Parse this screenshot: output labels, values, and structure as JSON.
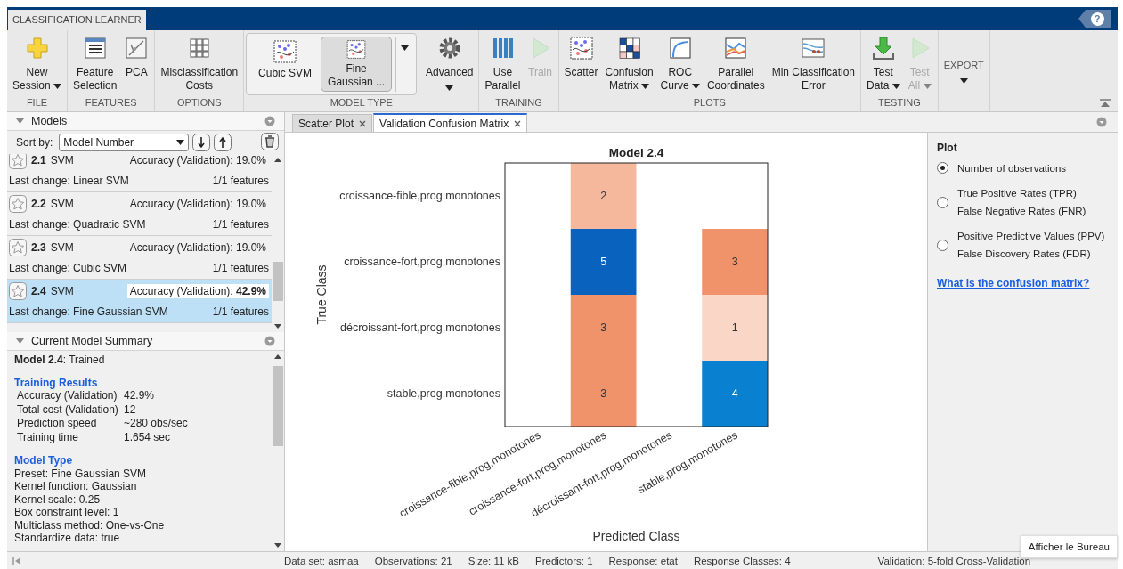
{
  "app": {
    "tab": "CLASSIFICATION LEARNER",
    "help": "?"
  },
  "toolstrip": {
    "sections": [
      {
        "label": "FILE",
        "buttons": [
          {
            "lines": [
              "New",
              "Session"
            ],
            "dropdown": true,
            "disabled": false
          }
        ]
      },
      {
        "label": "FEATURES",
        "buttons": [
          {
            "lines": [
              "Feature",
              "Selection"
            ],
            "disabled": false
          },
          {
            "lines": [
              "PCA"
            ],
            "disabled": false
          }
        ]
      },
      {
        "label": "OPTIONS",
        "buttons": [
          {
            "lines": [
              "Misclassification",
              "Costs"
            ],
            "disabled": false
          }
        ]
      },
      {
        "label": "MODEL TYPE",
        "gallery": [
          {
            "lines": [
              "Cubic SVM"
            ],
            "selected": false
          },
          {
            "lines": [
              "Fine",
              "Gaussian ..."
            ],
            "selected": true
          }
        ],
        "buttons": [
          {
            "lines": [
              "Advanced"
            ],
            "dropdown": true,
            "caret_below": true,
            "disabled": false
          }
        ]
      },
      {
        "label": "TRAINING",
        "buttons": [
          {
            "lines": [
              "Use",
              "Parallel"
            ],
            "disabled": false
          },
          {
            "lines": [
              "Train"
            ],
            "disabled": true
          }
        ]
      },
      {
        "label": "PLOTS",
        "buttons": [
          {
            "lines": [
              "Scatter"
            ],
            "disabled": false
          },
          {
            "lines": [
              "Confusion",
              "Matrix"
            ],
            "dropdown": true,
            "disabled": false
          },
          {
            "lines": [
              "ROC",
              "Curve"
            ],
            "dropdown": true,
            "disabled": false
          },
          {
            "lines": [
              "Parallel",
              "Coordinates"
            ],
            "disabled": false
          },
          {
            "lines": [
              "Min Classification",
              "Error"
            ],
            "disabled": false
          }
        ]
      },
      {
        "label": "TESTING",
        "buttons": [
          {
            "lines": [
              "Test",
              "Data"
            ],
            "dropdown": true,
            "disabled": false
          },
          {
            "lines": [
              "Test",
              "All"
            ],
            "dropdown": true,
            "disabled": true
          }
        ]
      },
      {
        "buttons": [
          {
            "lines": [
              "EXPORT"
            ],
            "dropdown": true,
            "caret_below": true,
            "disabled": false
          }
        ]
      }
    ]
  },
  "models": {
    "title": "Models",
    "sort_label": "Sort by:",
    "sort_value": "Model Number",
    "items": [
      {
        "number": "2.1",
        "type": "SVM",
        "accuracy": "Accuracy (Validation): 19.0%",
        "last_change": "Last change: Linear SVM",
        "features": "1/1 features",
        "starred": false,
        "selected": false
      },
      {
        "number": "2.2",
        "type": "SVM",
        "accuracy": "Accuracy (Validation): 19.0%",
        "last_change": "Last change: Quadratic SVM",
        "features": "1/1 features",
        "starred": false,
        "selected": false
      },
      {
        "number": "2.3",
        "type": "SVM",
        "accuracy": "Accuracy (Validation): 19.0%",
        "last_change": "Last change: Cubic SVM",
        "features": "1/1 features",
        "starred": false,
        "selected": false
      },
      {
        "number": "2.4",
        "type": "SVM",
        "accuracy": "Accuracy (Validation): **42.9%**",
        "last_change": "Last change: Fine Gaussian SVM",
        "features": "1/1 features",
        "starred": false,
        "selected": true
      }
    ]
  },
  "summary": {
    "title": "Current Model Summary",
    "heading": "**Model 2.4**: Trained",
    "sections": [
      {
        "title": "Training Results",
        "rows": [
          {
            "label": "Accuracy (Validation)",
            "value": "42.9%"
          },
          {
            "label": "Total cost (Validation)",
            "value": "12"
          },
          {
            "label": "Prediction speed",
            "value": "~280 obs/sec"
          },
          {
            "label": "Training time",
            "value": "1.654 sec"
          }
        ]
      },
      {
        "title": "Model Type",
        "lines": [
          "Preset: Fine Gaussian SVM",
          "Kernel function: Gaussian",
          "Kernel scale: 0.25",
          "Box constraint level: 1",
          "Multiclass method: One-vs-One",
          "Standardize data: true"
        ]
      }
    ]
  },
  "doc_tabs": [
    {
      "label": "Scatter Plot",
      "selected": false
    },
    {
      "label": "Validation Confusion Matrix",
      "selected": true
    }
  ],
  "matrix": {
    "title": "Model 2.4",
    "ylabel": "True Class",
    "xlabel": "Predicted Class",
    "column_labels": [
      "croissance-fible,prog,monotones",
      "croissance-fort,prog,monotones",
      "décroissant-fort,prog,monotones",
      "stable,prog,monotones"
    ],
    "rows": [
      {
        "label": "croissance-fible,prog,monotones",
        "cells": [
          null,
          {
            "value": "2",
            "color": "#f5b89c"
          },
          null,
          null
        ]
      },
      {
        "label": "croissance-fort,prog,monotones",
        "cells": [
          null,
          {
            "value": "5",
            "color": "#0a62bf"
          },
          null,
          {
            "value": "3",
            "color": "#f0936a"
          }
        ]
      },
      {
        "label": "décroissant-fort,prog,monotones",
        "cells": [
          null,
          {
            "value": "3",
            "color": "#f0936a"
          },
          null,
          {
            "value": "1",
            "color": "#fad6c6"
          }
        ]
      },
      {
        "label": "stable,prog,monotones",
        "cells": [
          null,
          {
            "value": "3",
            "color": "#f0936a"
          },
          null,
          {
            "value": "4",
            "color": "#0a80d0"
          }
        ]
      }
    ]
  },
  "plot_options": {
    "title": "Plot",
    "options": [
      {
        "lines": [
          "Number of observations"
        ],
        "selected": true
      },
      {
        "lines": [
          "True Positive Rates (TPR)",
          "False Negative Rates (FNR)"
        ],
        "selected": false
      },
      {
        "lines": [
          "Positive Predictive Values (PPV)",
          "False Discovery Rates (FDR)"
        ],
        "selected": false
      }
    ],
    "link": "What is the confusion matrix?"
  },
  "status_bar": [
    "Data set: asmaa",
    "Observations: 21",
    "Size: 11 kB",
    "Predictors: 1",
    "Response: etat",
    "Response Classes: 4",
    "Validation: 5-fold Cross-Validation"
  ],
  "tooltip": "Afficher le Bureau"
}
